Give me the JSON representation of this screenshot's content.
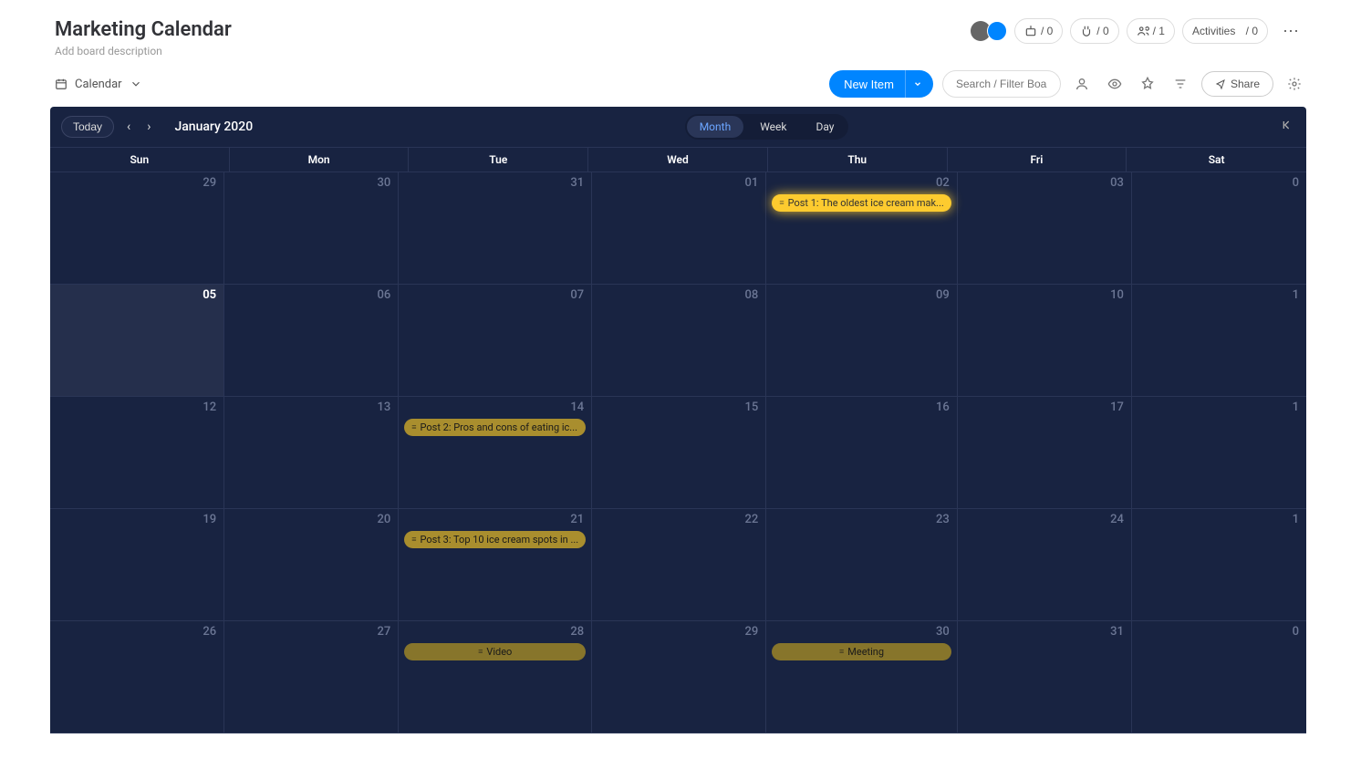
{
  "board": {
    "title": "Marketing Calendar",
    "descriptionPlaceholder": "Add board description"
  },
  "headerButtons": {
    "automations": {
      "count": "/ 0"
    },
    "integrations": {
      "count": "/ 0"
    },
    "people": {
      "count": "/ 1"
    },
    "activities": {
      "label": "Activities",
      "count": "/ 0"
    }
  },
  "viewSwitch": {
    "label": "Calendar"
  },
  "toolbar": {
    "newItem": "New Item",
    "searchPlaceholder": "Search / Filter Board",
    "share": "Share"
  },
  "calendar": {
    "todayLabel": "Today",
    "monthLabel": "January 2020",
    "ranges": {
      "month": "Month",
      "week": "Week",
      "day": "Day"
    },
    "dayHeaders": [
      "Sun",
      "Mon",
      "Tue",
      "Wed",
      "Thu",
      "Fri",
      "Sat"
    ],
    "days": [
      {
        "date": "29",
        "events": []
      },
      {
        "date": "30",
        "events": []
      },
      {
        "date": "31",
        "events": []
      },
      {
        "date": "01",
        "events": []
      },
      {
        "date": "02",
        "events": [
          {
            "title": "Post 1: The oldest ice cream mak...",
            "style": "highlight"
          }
        ]
      },
      {
        "date": "03",
        "events": []
      },
      {
        "date": "0",
        "events": []
      },
      {
        "date": "05",
        "today": true,
        "events": []
      },
      {
        "date": "06",
        "events": []
      },
      {
        "date": "07",
        "events": []
      },
      {
        "date": "08",
        "events": []
      },
      {
        "date": "09",
        "events": []
      },
      {
        "date": "10",
        "events": []
      },
      {
        "date": "1",
        "events": []
      },
      {
        "date": "12",
        "events": []
      },
      {
        "date": "13",
        "events": []
      },
      {
        "date": "14",
        "events": [
          {
            "title": "Post 2: Pros and cons of eating ic...",
            "style": "dim"
          }
        ]
      },
      {
        "date": "15",
        "events": []
      },
      {
        "date": "16",
        "events": []
      },
      {
        "date": "17",
        "events": []
      },
      {
        "date": "1",
        "events": []
      },
      {
        "date": "19",
        "events": []
      },
      {
        "date": "20",
        "events": []
      },
      {
        "date": "21",
        "events": [
          {
            "title": "Post 3: Top 10 ice cream spots in ...",
            "style": "dim"
          }
        ]
      },
      {
        "date": "22",
        "events": []
      },
      {
        "date": "23",
        "events": []
      },
      {
        "date": "24",
        "events": []
      },
      {
        "date": "1",
        "events": []
      },
      {
        "date": "26",
        "events": []
      },
      {
        "date": "27",
        "events": []
      },
      {
        "date": "28",
        "events": [
          {
            "title": "Video",
            "style": "dim2",
            "centered": true
          }
        ]
      },
      {
        "date": "29",
        "events": []
      },
      {
        "date": "30",
        "events": [
          {
            "title": "Meeting",
            "style": "dim2",
            "centered": true
          }
        ]
      },
      {
        "date": "31",
        "events": []
      },
      {
        "date": "0",
        "events": []
      }
    ]
  }
}
